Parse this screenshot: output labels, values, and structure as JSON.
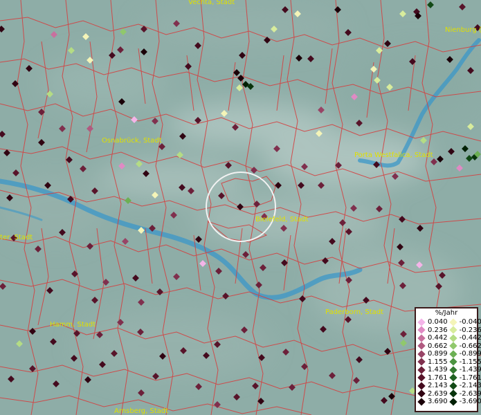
{
  "map": {
    "cities": [
      {
        "name": "Vechta, Stadt"
      },
      {
        "name": "Nienburg ("
      },
      {
        "name": "Osnabrück, Stadt"
      },
      {
        "name": "Porta Westfalica, Stadt"
      },
      {
        "name": "Bielefeld, Stadt"
      },
      {
        "name": "ter, Stadt"
      },
      {
        "name": "Paderborn, Stadt"
      },
      {
        "name": "Hamm, Stadt"
      },
      {
        "name": "Arnsberg, Stadt"
      }
    ]
  },
  "legend": {
    "title": "%/Jahr",
    "positive": [
      {
        "label": "0.040",
        "color": "#f4b4e8"
      },
      {
        "label": "0.236",
        "color": "#e08ac4"
      },
      {
        "label": "0.442",
        "color": "#c8709e"
      },
      {
        "label": "0.662",
        "color": "#b05a80"
      },
      {
        "label": "0.899",
        "color": "#984466"
      },
      {
        "label": "1.155",
        "color": "#80304e"
      },
      {
        "label": "1.439",
        "color": "#6c203a"
      },
      {
        "label": "1.761",
        "color": "#58142a"
      },
      {
        "label": "2.143",
        "color": "#440a1e"
      },
      {
        "label": "2.639",
        "color": "#300412"
      },
      {
        "label": "3.690",
        "color": "#1a0008"
      }
    ],
    "negative": [
      {
        "label": "-0.040",
        "color": "#f4f4b8"
      },
      {
        "label": "-0.236",
        "color": "#d8ec9c"
      },
      {
        "label": "-0.442",
        "color": "#b4dc84"
      },
      {
        "label": "-0.662",
        "color": "#90c86c"
      },
      {
        "label": "-0.899",
        "color": "#6cb054"
      },
      {
        "label": "-1.155",
        "color": "#4c9440"
      },
      {
        "label": "-1.439",
        "color": "#347a30"
      },
      {
        "label": "-1.761",
        "color": "#206222"
      },
      {
        "label": "-2.143",
        "color": "#124a16"
      },
      {
        "label": "-2.639",
        "color": "#08340c"
      },
      {
        "label": "-3.690",
        "color": "#002004"
      }
    ]
  }
}
